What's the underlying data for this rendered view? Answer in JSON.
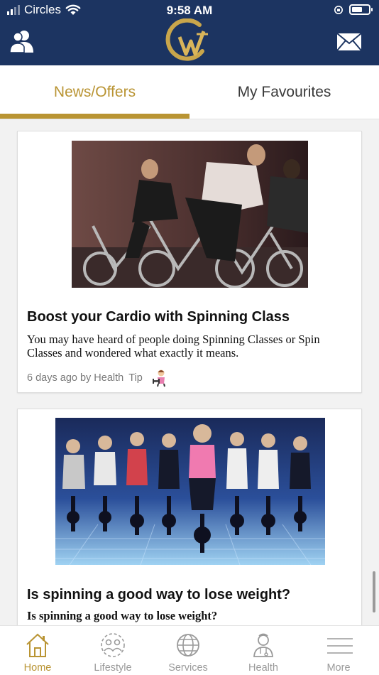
{
  "status": {
    "carrier": "Circles",
    "time": "9:58 AM"
  },
  "header": {
    "profile_icon": "user-icon",
    "logo": "gw-logo",
    "mail_icon": "envelope-icon"
  },
  "tabs": [
    {
      "label": "News/Offers",
      "active": true
    },
    {
      "label": "My Favourites",
      "active": false
    }
  ],
  "feed": [
    {
      "title": "Boost your Cardio with Spinning Class",
      "description": "You may have heard of people doing Spinning Classes or Spin Classes and wondered what exactly it means.",
      "age": "6 days ago by",
      "category": "Health",
      "tip": "Tip",
      "tip_icon": "fitness-person-icon"
    },
    {
      "title": "Is spinning a good way to lose weight?",
      "description": "Is spinning a good way to lose weight?"
    }
  ],
  "bottom_nav": [
    {
      "label": "Home",
      "icon": "home-icon",
      "active": true
    },
    {
      "label": "Lifestyle",
      "icon": "people-icon",
      "active": false
    },
    {
      "label": "Services",
      "icon": "globe-icon",
      "active": false
    },
    {
      "label": "Health",
      "icon": "doctor-icon",
      "active": false
    },
    {
      "label": "More",
      "icon": "menu-icon",
      "active": false
    }
  ],
  "colors": {
    "navy": "#1c3461",
    "gold": "#b99433"
  }
}
